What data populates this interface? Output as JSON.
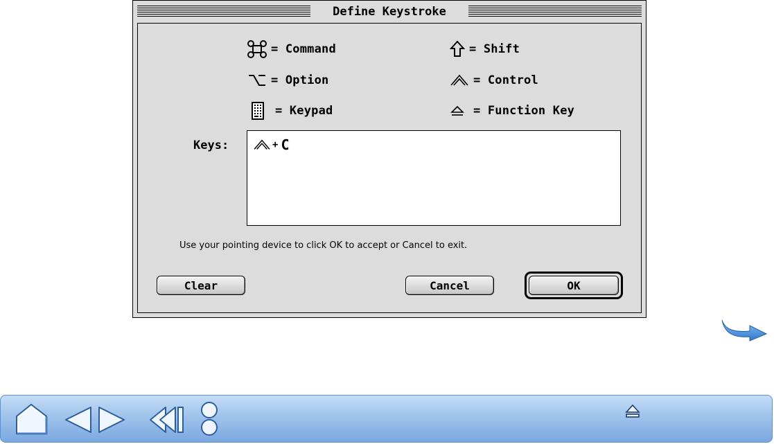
{
  "dialog": {
    "title": "Define Keystroke",
    "legend": [
      {
        "symbol": "command-icon",
        "text": "= Command"
      },
      {
        "symbol": "shift-icon",
        "text": "= Shift"
      },
      {
        "symbol": "option-icon",
        "text": "= Option"
      },
      {
        "symbol": "control-icon",
        "text": "= Control"
      },
      {
        "symbol": "keypad-icon",
        "text": "= Keypad"
      },
      {
        "symbol": "function-key-icon",
        "text": "= Function Key"
      }
    ],
    "keys_label": "Keys:",
    "keys_value": {
      "modifier": "control-icon",
      "plus": "+",
      "key": "C"
    },
    "hint": "Use your pointing device to click OK to accept or Cancel to exit.",
    "buttons": {
      "clear": "Clear",
      "cancel": "Cancel",
      "ok": "OK"
    }
  },
  "navigation": {
    "items": [
      "home-icon",
      "previous-page-icon",
      "next-page-icon",
      "back-icon",
      "pages-icon",
      "eject-icon"
    ],
    "colors": {
      "bar": "#9fc3ec",
      "bar_dark": "#5a8fd0",
      "arrow": "#3b86d8"
    }
  }
}
